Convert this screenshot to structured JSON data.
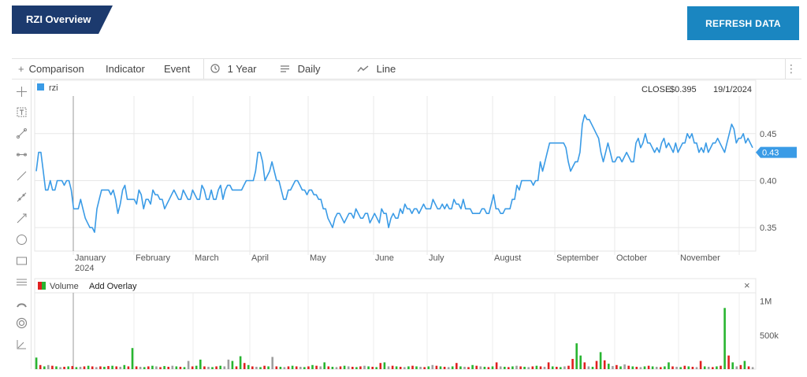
{
  "header": {
    "title": "RZI Overview",
    "refresh_label": "REFRESH DATA"
  },
  "toolbar": {
    "comparison": "Comparison",
    "indicator": "Indicator",
    "event": "Event",
    "range": "1 Year",
    "interval": "Daily",
    "style": "Line"
  },
  "colors": {
    "line": "#3a9be6",
    "up": "#28b530",
    "down": "#e02020",
    "flat": "#9e9e9e",
    "brand": "#1c3a6e",
    "button": "#1a86c1"
  },
  "chart_data": [
    {
      "type": "line",
      "legend": "rzi",
      "close_label": "CLOSE",
      "close_value": "$0.395",
      "close_date": "19/1/2024",
      "last_value_badge": "0.43",
      "y_ticks": [
        "0.45",
        "0.40",
        "0.35"
      ],
      "ylim": [
        0.325,
        0.49
      ],
      "x_month_labels": [
        "January",
        "February",
        "March",
        "April",
        "May",
        "June",
        "July",
        "August",
        "September",
        "October",
        "November"
      ],
      "x_year_label": "2024",
      "values": [
        0.41,
        0.43,
        0.43,
        0.41,
        0.39,
        0.39,
        0.4,
        0.39,
        0.39,
        0.4,
        0.4,
        0.4,
        0.395,
        0.4,
        0.4,
        0.39,
        0.37,
        0.37,
        0.37,
        0.38,
        0.37,
        0.36,
        0.355,
        0.35,
        0.35,
        0.345,
        0.37,
        0.38,
        0.39,
        0.39,
        0.39,
        0.39,
        0.385,
        0.39,
        0.38,
        0.365,
        0.375,
        0.39,
        0.395,
        0.38,
        0.38,
        0.38,
        0.38,
        0.375,
        0.39,
        0.385,
        0.37,
        0.38,
        0.38,
        0.375,
        0.39,
        0.385,
        0.385,
        0.38,
        0.38,
        0.37,
        0.375,
        0.38,
        0.385,
        0.39,
        0.385,
        0.38,
        0.38,
        0.39,
        0.385,
        0.38,
        0.38,
        0.39,
        0.385,
        0.38,
        0.38,
        0.395,
        0.39,
        0.38,
        0.38,
        0.39,
        0.38,
        0.38,
        0.39,
        0.395,
        0.38,
        0.39,
        0.395,
        0.395,
        0.39,
        0.39,
        0.39,
        0.39,
        0.39,
        0.395,
        0.4,
        0.4,
        0.4,
        0.4,
        0.41,
        0.43,
        0.43,
        0.42,
        0.4,
        0.405,
        0.41,
        0.42,
        0.41,
        0.4,
        0.4,
        0.39,
        0.38,
        0.38,
        0.39,
        0.39,
        0.395,
        0.4,
        0.4,
        0.395,
        0.39,
        0.39,
        0.385,
        0.39,
        0.39,
        0.385,
        0.385,
        0.38,
        0.38,
        0.37,
        0.37,
        0.36,
        0.355,
        0.35,
        0.36,
        0.365,
        0.365,
        0.36,
        0.355,
        0.36,
        0.365,
        0.365,
        0.36,
        0.37,
        0.365,
        0.36,
        0.36,
        0.365,
        0.365,
        0.355,
        0.36,
        0.365,
        0.36,
        0.355,
        0.37,
        0.365,
        0.365,
        0.35,
        0.36,
        0.365,
        0.36,
        0.36,
        0.37,
        0.365,
        0.375,
        0.37,
        0.37,
        0.365,
        0.37,
        0.37,
        0.365,
        0.37,
        0.375,
        0.37,
        0.37,
        0.37,
        0.38,
        0.375,
        0.37,
        0.37,
        0.375,
        0.37,
        0.375,
        0.37,
        0.37,
        0.38,
        0.375,
        0.375,
        0.37,
        0.38,
        0.37,
        0.37,
        0.37,
        0.365,
        0.365,
        0.365,
        0.365,
        0.37,
        0.37,
        0.365,
        0.365,
        0.375,
        0.385,
        0.37,
        0.37,
        0.365,
        0.365,
        0.37,
        0.37,
        0.37,
        0.38,
        0.38,
        0.395,
        0.39,
        0.4,
        0.4,
        0.4,
        0.4,
        0.4,
        0.395,
        0.4,
        0.4,
        0.42,
        0.41,
        0.42,
        0.43,
        0.44,
        0.44,
        0.44,
        0.44,
        0.44,
        0.44,
        0.44,
        0.435,
        0.42,
        0.41,
        0.415,
        0.42,
        0.42,
        0.43,
        0.46,
        0.47,
        0.465,
        0.465,
        0.46,
        0.455,
        0.45,
        0.445,
        0.43,
        0.42,
        0.43,
        0.44,
        0.43,
        0.42,
        0.42,
        0.425,
        0.425,
        0.42,
        0.425,
        0.43,
        0.425,
        0.42,
        0.42,
        0.44,
        0.445,
        0.435,
        0.44,
        0.45,
        0.44,
        0.44,
        0.435,
        0.43,
        0.435,
        0.43,
        0.44,
        0.445,
        0.435,
        0.44,
        0.435,
        0.43,
        0.44,
        0.43,
        0.435,
        0.44,
        0.44,
        0.45,
        0.445,
        0.45,
        0.44,
        0.44,
        0.43,
        0.435,
        0.43,
        0.44,
        0.43,
        0.435,
        0.44,
        0.44,
        0.445,
        0.44,
        0.435,
        0.43,
        0.44,
        0.45,
        0.46,
        0.455,
        0.44,
        0.445,
        0.445,
        0.45,
        0.44,
        0.445,
        0.44,
        0.435
      ],
      "volume": {
        "legend": "Volume",
        "add_overlay_label": "Add Overlay",
        "close_symbol": "×",
        "y_ticks": [
          "1M",
          "500k"
        ],
        "ylim": [
          0,
          1100000
        ],
        "bars": [
          [
            170000,
            "up"
          ],
          [
            60000,
            "down"
          ],
          [
            40000,
            "up"
          ],
          [
            60000,
            "flat"
          ],
          [
            50000,
            "down"
          ],
          [
            40000,
            "up"
          ],
          [
            30000,
            "flat"
          ],
          [
            35000,
            "down"
          ],
          [
            40000,
            "up"
          ],
          [
            45000,
            "down"
          ],
          [
            30000,
            "up"
          ],
          [
            35000,
            "flat"
          ],
          [
            40000,
            "down"
          ],
          [
            50000,
            "up"
          ],
          [
            40000,
            "down"
          ],
          [
            30000,
            "flat"
          ],
          [
            40000,
            "down"
          ],
          [
            35000,
            "up"
          ],
          [
            45000,
            "down"
          ],
          [
            50000,
            "up"
          ],
          [
            40000,
            "down"
          ],
          [
            35000,
            "flat"
          ],
          [
            60000,
            "up"
          ],
          [
            40000,
            "down"
          ],
          [
            310000,
            "up"
          ],
          [
            40000,
            "down"
          ],
          [
            35000,
            "flat"
          ],
          [
            30000,
            "up"
          ],
          [
            40000,
            "down"
          ],
          [
            50000,
            "up"
          ],
          [
            40000,
            "flat"
          ],
          [
            30000,
            "down"
          ],
          [
            45000,
            "up"
          ],
          [
            35000,
            "down"
          ],
          [
            50000,
            "flat"
          ],
          [
            40000,
            "up"
          ],
          [
            35000,
            "down"
          ],
          [
            30000,
            "up"
          ],
          [
            120000,
            "flat"
          ],
          [
            40000,
            "down"
          ],
          [
            50000,
            "up"
          ],
          [
            140000,
            "up"
          ],
          [
            40000,
            "down"
          ],
          [
            35000,
            "flat"
          ],
          [
            30000,
            "up"
          ],
          [
            40000,
            "down"
          ],
          [
            50000,
            "up"
          ],
          [
            40000,
            "flat"
          ],
          [
            140000,
            "flat"
          ],
          [
            120000,
            "up"
          ],
          [
            40000,
            "down"
          ],
          [
            190000,
            "up"
          ],
          [
            90000,
            "down"
          ],
          [
            60000,
            "up"
          ],
          [
            40000,
            "down"
          ],
          [
            35000,
            "flat"
          ],
          [
            30000,
            "up"
          ],
          [
            50000,
            "down"
          ],
          [
            40000,
            "up"
          ],
          [
            180000,
            "flat"
          ],
          [
            40000,
            "down"
          ],
          [
            35000,
            "up"
          ],
          [
            30000,
            "flat"
          ],
          [
            40000,
            "down"
          ],
          [
            50000,
            "up"
          ],
          [
            40000,
            "down"
          ],
          [
            35000,
            "flat"
          ],
          [
            30000,
            "up"
          ],
          [
            40000,
            "down"
          ],
          [
            60000,
            "up"
          ],
          [
            50000,
            "down"
          ],
          [
            40000,
            "flat"
          ],
          [
            100000,
            "up"
          ],
          [
            40000,
            "down"
          ],
          [
            35000,
            "up"
          ],
          [
            30000,
            "flat"
          ],
          [
            40000,
            "down"
          ],
          [
            50000,
            "up"
          ],
          [
            40000,
            "flat"
          ],
          [
            35000,
            "down"
          ],
          [
            30000,
            "up"
          ],
          [
            40000,
            "down"
          ],
          [
            50000,
            "flat"
          ],
          [
            40000,
            "up"
          ],
          [
            35000,
            "down"
          ],
          [
            30000,
            "up"
          ],
          [
            90000,
            "down"
          ],
          [
            100000,
            "up"
          ],
          [
            40000,
            "flat"
          ],
          [
            50000,
            "down"
          ],
          [
            40000,
            "up"
          ],
          [
            35000,
            "down"
          ],
          [
            30000,
            "flat"
          ],
          [
            40000,
            "up"
          ],
          [
            50000,
            "down"
          ],
          [
            40000,
            "up"
          ],
          [
            35000,
            "flat"
          ],
          [
            30000,
            "down"
          ],
          [
            40000,
            "up"
          ],
          [
            60000,
            "flat"
          ],
          [
            50000,
            "down"
          ],
          [
            40000,
            "up"
          ],
          [
            35000,
            "down"
          ],
          [
            30000,
            "flat"
          ],
          [
            40000,
            "up"
          ],
          [
            90000,
            "down"
          ],
          [
            40000,
            "up"
          ],
          [
            35000,
            "flat"
          ],
          [
            30000,
            "down"
          ],
          [
            60000,
            "up"
          ],
          [
            50000,
            "down"
          ],
          [
            40000,
            "flat"
          ],
          [
            35000,
            "up"
          ],
          [
            30000,
            "down"
          ],
          [
            40000,
            "up"
          ],
          [
            100000,
            "down"
          ],
          [
            40000,
            "flat"
          ],
          [
            35000,
            "up"
          ],
          [
            30000,
            "down"
          ],
          [
            40000,
            "up"
          ],
          [
            50000,
            "flat"
          ],
          [
            40000,
            "down"
          ],
          [
            35000,
            "up"
          ],
          [
            30000,
            "flat"
          ],
          [
            40000,
            "down"
          ],
          [
            50000,
            "up"
          ],
          [
            40000,
            "down"
          ],
          [
            35000,
            "flat"
          ],
          [
            100000,
            "down"
          ],
          [
            40000,
            "up"
          ],
          [
            35000,
            "down"
          ],
          [
            30000,
            "up"
          ],
          [
            40000,
            "flat"
          ],
          [
            50000,
            "down"
          ],
          [
            150000,
            "down"
          ],
          [
            380000,
            "up"
          ],
          [
            200000,
            "up"
          ],
          [
            100000,
            "down"
          ],
          [
            40000,
            "flat"
          ],
          [
            35000,
            "up"
          ],
          [
            120000,
            "down"
          ],
          [
            250000,
            "up"
          ],
          [
            130000,
            "down"
          ],
          [
            80000,
            "up"
          ],
          [
            45000,
            "flat"
          ],
          [
            60000,
            "down"
          ],
          [
            40000,
            "up"
          ],
          [
            70000,
            "flat"
          ],
          [
            50000,
            "down"
          ],
          [
            40000,
            "up"
          ],
          [
            35000,
            "down"
          ],
          [
            30000,
            "flat"
          ],
          [
            40000,
            "up"
          ],
          [
            50000,
            "down"
          ],
          [
            40000,
            "up"
          ],
          [
            35000,
            "flat"
          ],
          [
            30000,
            "down"
          ],
          [
            40000,
            "up"
          ],
          [
            100000,
            "up"
          ],
          [
            40000,
            "down"
          ],
          [
            35000,
            "flat"
          ],
          [
            30000,
            "up"
          ],
          [
            50000,
            "down"
          ],
          [
            40000,
            "up"
          ],
          [
            35000,
            "down"
          ],
          [
            30000,
            "flat"
          ],
          [
            120000,
            "down"
          ],
          [
            40000,
            "up"
          ],
          [
            35000,
            "flat"
          ],
          [
            30000,
            "down"
          ],
          [
            40000,
            "up"
          ],
          [
            50000,
            "down"
          ],
          [
            900000,
            "up"
          ],
          [
            200000,
            "down"
          ],
          [
            100000,
            "up"
          ],
          [
            40000,
            "flat"
          ],
          [
            60000,
            "down"
          ],
          [
            120000,
            "up"
          ],
          [
            40000,
            "down"
          ],
          [
            30000,
            "flat"
          ]
        ]
      }
    }
  ]
}
